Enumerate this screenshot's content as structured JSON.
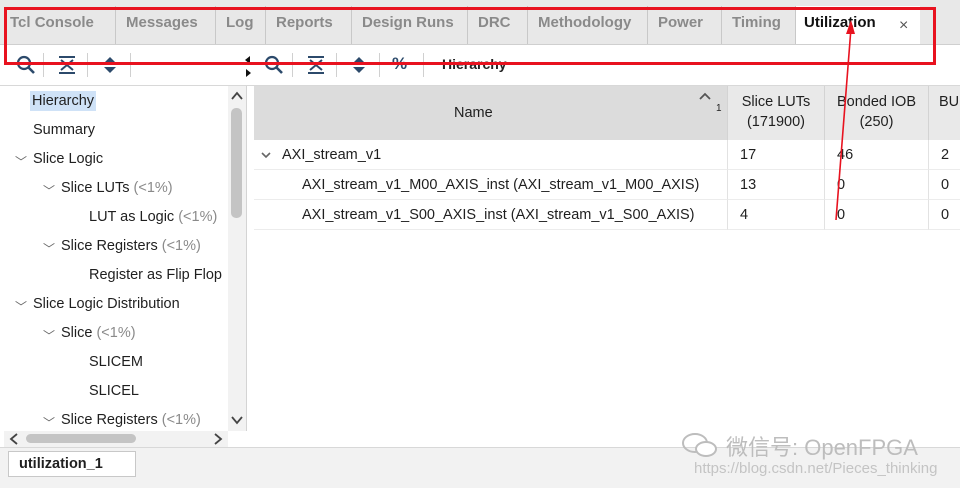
{
  "tabs": [
    {
      "label": "Tcl Console"
    },
    {
      "label": "Messages"
    },
    {
      "label": "Log"
    },
    {
      "label": "Reports"
    },
    {
      "label": "Design Runs"
    },
    {
      "label": "DRC"
    },
    {
      "label": "Methodology"
    },
    {
      "label": "Power"
    },
    {
      "label": "Timing"
    },
    {
      "label": "Utilization"
    }
  ],
  "active_tab_close": "×",
  "toolbar": {
    "title": "Hierarchy",
    "percent_label": "%"
  },
  "tree": {
    "items": [
      {
        "label": "Hierarchy"
      },
      {
        "label": "Summary"
      },
      {
        "label": "Slice Logic"
      },
      {
        "label": "Slice LUTs",
        "pct": "(<1%)"
      },
      {
        "label": "LUT as Logic",
        "pct": "(<1%)"
      },
      {
        "label": "Slice Registers",
        "pct": "(<1%)"
      },
      {
        "label": "Register as Flip Flop"
      },
      {
        "label": "Slice Logic Distribution"
      },
      {
        "label": "Slice",
        "pct": "(<1%)"
      },
      {
        "label": "SLICEM"
      },
      {
        "label": "SLICEL"
      },
      {
        "label": "Slice Registers",
        "pct": "(<1%)"
      }
    ]
  },
  "table": {
    "headers": {
      "name": "Name",
      "sort_index": "1",
      "slice_luts": "Slice LUTs",
      "slice_luts_total": "(171900)",
      "bonded_iob": "Bonded IOB",
      "bonded_iob_total": "(250)",
      "bu": "BU"
    },
    "rows": [
      {
        "name": "AXI_stream_v1",
        "luts": "17",
        "iob": "46",
        "bu": "2"
      },
      {
        "name": "AXI_stream_v1_M00_AXIS_inst (AXI_stream_v1_M00_AXIS)",
        "luts": "13",
        "iob": "0",
        "bu": "0"
      },
      {
        "name": "AXI_stream_v1_S00_AXIS_inst (AXI_stream_v1_S00_AXIS)",
        "luts": "4",
        "iob": "0",
        "bu": "0"
      }
    ]
  },
  "bottom_tab": "utilization_1",
  "watermark": {
    "main": "微信号: OpenFPGA",
    "url": "https://blog.csdn.net/Pieces_thinking"
  },
  "colors": {
    "highlight": "#e8121f",
    "selection": "#cfe2f7",
    "icon": "#2c4a6b"
  }
}
